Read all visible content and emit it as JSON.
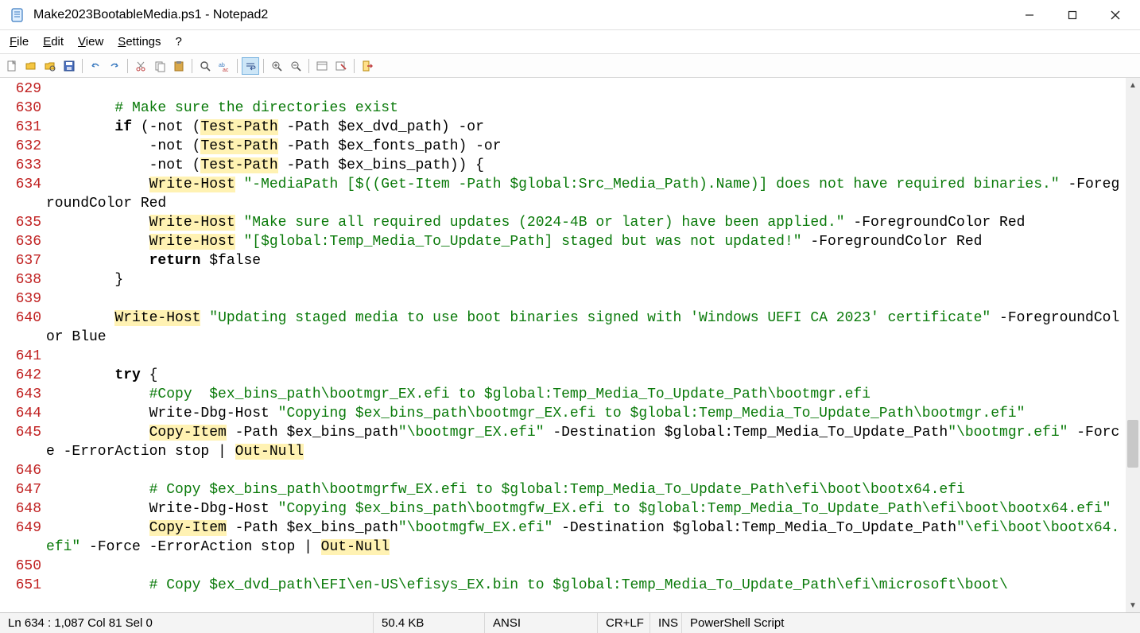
{
  "window": {
    "title": "Make2023BootableMedia.ps1 - Notepad2"
  },
  "menus": {
    "file": "File",
    "edit": "Edit",
    "view": "View",
    "settings": "Settings",
    "help": "?"
  },
  "status": {
    "pos": "Ln 634 : 1,087   Col 81   Sel 0",
    "size": "50.4 KB",
    "enc": "ANSI",
    "eol": "CR+LF",
    "mode": "INS",
    "lang": "PowerShell Script"
  },
  "lines": [
    {
      "num": 629,
      "segs": []
    },
    {
      "num": 630,
      "segs": [
        {
          "t": "        ",
          "c": ""
        },
        {
          "t": "# Make sure the directories exist",
          "c": "cmt"
        }
      ]
    },
    {
      "num": 631,
      "segs": [
        {
          "t": "        ",
          "c": ""
        },
        {
          "t": "if",
          "c": "kw"
        },
        {
          "t": " (-not (",
          "c": ""
        },
        {
          "t": "Test-Path",
          "c": "hl"
        },
        {
          "t": " -Path $ex_dvd_path) -or",
          "c": ""
        }
      ]
    },
    {
      "num": 632,
      "segs": [
        {
          "t": "            -not (",
          "c": ""
        },
        {
          "t": "Test-Path",
          "c": "hl"
        },
        {
          "t": " -Path $ex_fonts_path) -or",
          "c": ""
        }
      ]
    },
    {
      "num": 633,
      "segs": [
        {
          "t": "            -not (",
          "c": ""
        },
        {
          "t": "Test-Path",
          "c": "hl"
        },
        {
          "t": " -Path $ex_bins_path)) {",
          "c": ""
        }
      ]
    },
    {
      "num": 634,
      "segs": [
        {
          "t": "            ",
          "c": ""
        },
        {
          "t": "Write-Host",
          "c": "hl"
        },
        {
          "t": " ",
          "c": ""
        },
        {
          "t": "\"-MediaPath [$((Get-Item -Path $global:Src_Media_Path).Name)] does not have required binaries.\"",
          "c": "str"
        },
        {
          "t": " -ForegroundColor Red",
          "c": ""
        }
      ]
    },
    {
      "num": 635,
      "segs": [
        {
          "t": "            ",
          "c": ""
        },
        {
          "t": "Write-Host",
          "c": "hl"
        },
        {
          "t": " ",
          "c": ""
        },
        {
          "t": "\"Make sure all required updates (2024-4B or later) have been applied.\"",
          "c": "str"
        },
        {
          "t": " -ForegroundColor Red",
          "c": ""
        }
      ]
    },
    {
      "num": 636,
      "segs": [
        {
          "t": "            ",
          "c": ""
        },
        {
          "t": "Write-Host",
          "c": "hl"
        },
        {
          "t": " ",
          "c": ""
        },
        {
          "t": "\"[$global:Temp_Media_To_Update_Path] staged but was not updated!\"",
          "c": "str"
        },
        {
          "t": " -ForegroundColor Red",
          "c": ""
        }
      ]
    },
    {
      "num": 637,
      "segs": [
        {
          "t": "            ",
          "c": ""
        },
        {
          "t": "return",
          "c": "kw"
        },
        {
          "t": " $false",
          "c": ""
        }
      ]
    },
    {
      "num": 638,
      "segs": [
        {
          "t": "        }",
          "c": ""
        }
      ]
    },
    {
      "num": 639,
      "segs": []
    },
    {
      "num": 640,
      "segs": [
        {
          "t": "        ",
          "c": ""
        },
        {
          "t": "Write-Host",
          "c": "hl"
        },
        {
          "t": " ",
          "c": ""
        },
        {
          "t": "\"Updating staged media to use boot binaries signed with 'Windows UEFI CA 2023' certificate\"",
          "c": "str"
        },
        {
          "t": " -ForegroundColor Blue",
          "c": ""
        }
      ]
    },
    {
      "num": 641,
      "segs": []
    },
    {
      "num": 642,
      "segs": [
        {
          "t": "        ",
          "c": ""
        },
        {
          "t": "try",
          "c": "kw"
        },
        {
          "t": " {",
          "c": ""
        }
      ]
    },
    {
      "num": 643,
      "segs": [
        {
          "t": "            ",
          "c": ""
        },
        {
          "t": "#Copy  $ex_bins_path\\bootmgr_EX.efi to $global:Temp_Media_To_Update_Path\\bootmgr.efi",
          "c": "cmt"
        }
      ]
    },
    {
      "num": 644,
      "segs": [
        {
          "t": "            Write-Dbg-Host ",
          "c": ""
        },
        {
          "t": "\"Copying $ex_bins_path\\bootmgr_EX.efi to $global:Temp_Media_To_Update_Path\\bootmgr.efi\"",
          "c": "str"
        }
      ]
    },
    {
      "num": 645,
      "segs": [
        {
          "t": "            ",
          "c": ""
        },
        {
          "t": "Copy-Item",
          "c": "hl"
        },
        {
          "t": " -Path $ex_bins_path",
          "c": ""
        },
        {
          "t": "\"\\bootmgr_EX.efi\"",
          "c": "str"
        },
        {
          "t": " -Destination $global:Temp_Media_To_Update_Path",
          "c": ""
        },
        {
          "t": "\"\\bootmgr.efi\"",
          "c": "str"
        },
        {
          "t": " -Force -ErrorAction stop | ",
          "c": ""
        },
        {
          "t": "Out-Null",
          "c": "hl"
        }
      ]
    },
    {
      "num": 646,
      "segs": []
    },
    {
      "num": 647,
      "segs": [
        {
          "t": "            ",
          "c": ""
        },
        {
          "t": "# Copy $ex_bins_path\\bootmgrfw_EX.efi to $global:Temp_Media_To_Update_Path\\efi\\boot\\bootx64.efi",
          "c": "cmt"
        }
      ]
    },
    {
      "num": 648,
      "segs": [
        {
          "t": "            Write-Dbg-Host ",
          "c": ""
        },
        {
          "t": "\"Copying $ex_bins_path\\bootmgfw_EX.efi to $global:Temp_Media_To_Update_Path\\efi\\boot\\bootx64.efi\"",
          "c": "str"
        }
      ]
    },
    {
      "num": 649,
      "segs": [
        {
          "t": "            ",
          "c": ""
        },
        {
          "t": "Copy-Item",
          "c": "hl"
        },
        {
          "t": " -Path $ex_bins_path",
          "c": ""
        },
        {
          "t": "\"\\bootmgfw_EX.efi\"",
          "c": "str"
        },
        {
          "t": " -Destination $global:Temp_Media_To_Update_Path",
          "c": ""
        },
        {
          "t": "\"\\efi\\boot\\bootx64.efi\"",
          "c": "str"
        },
        {
          "t": " -Force -ErrorAction stop | ",
          "c": ""
        },
        {
          "t": "Out-Null",
          "c": "hl"
        }
      ]
    },
    {
      "num": 650,
      "segs": []
    },
    {
      "num": 651,
      "segs": [
        {
          "t": "            ",
          "c": ""
        },
        {
          "t": "# Copy $ex_dvd_path\\EFI\\en-US\\efisys_EX.bin to $global:Temp_Media_To_Update_Path\\efi\\microsoft\\boot\\",
          "c": "cmt"
        }
      ]
    }
  ]
}
